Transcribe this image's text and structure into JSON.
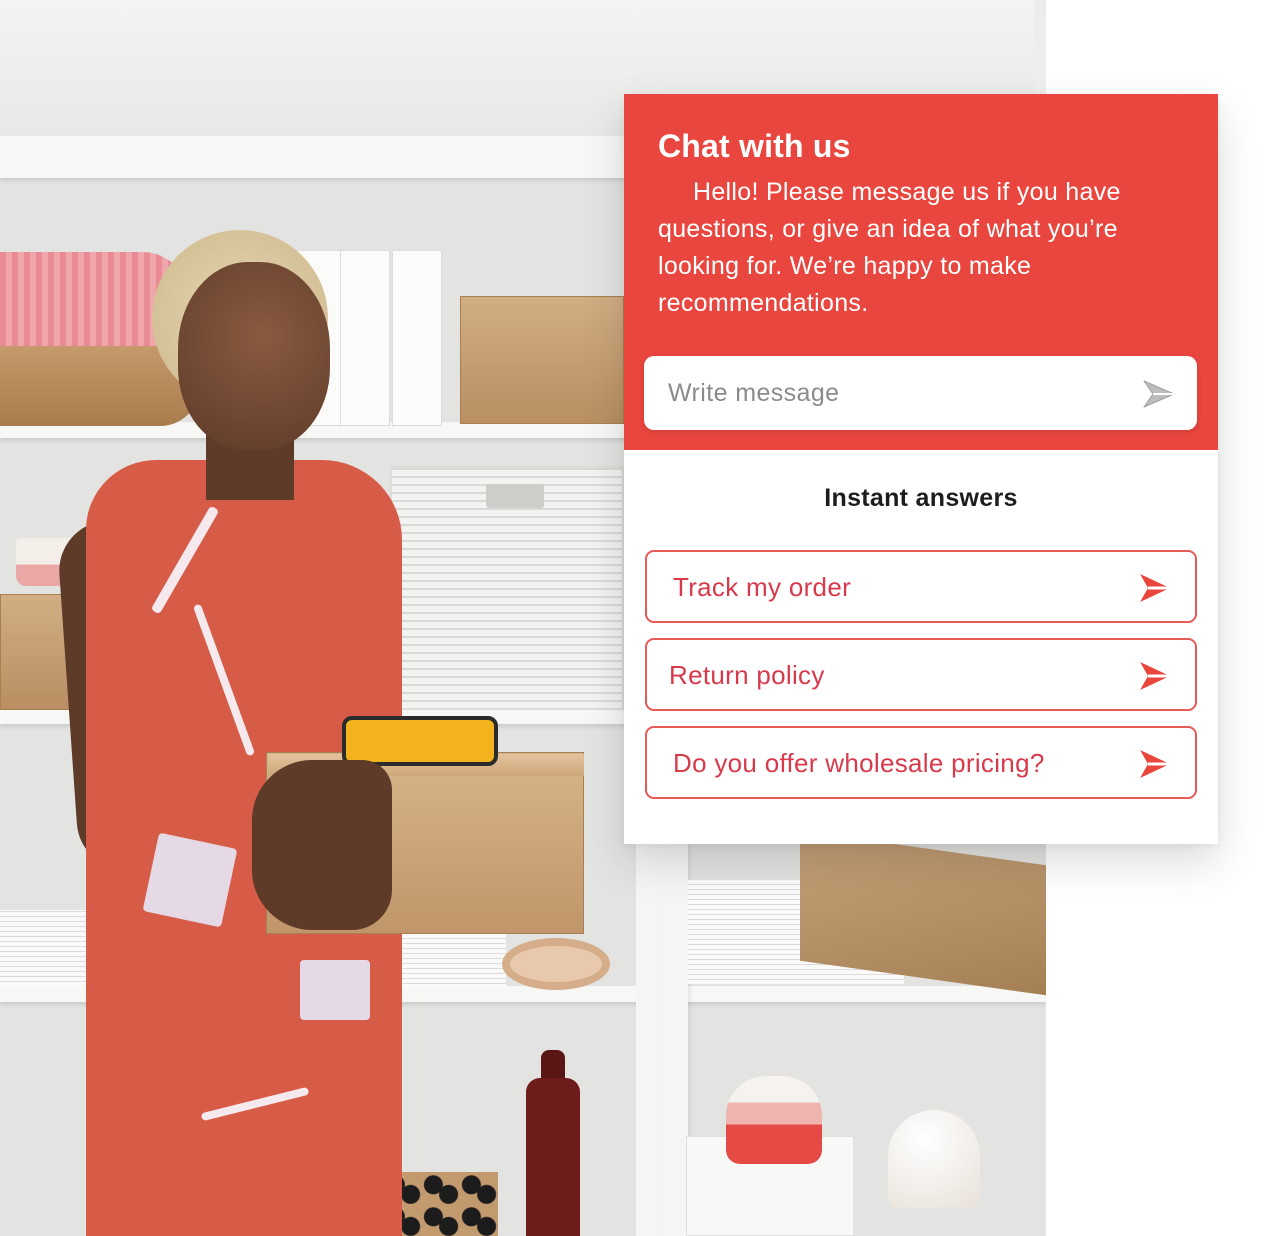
{
  "chat": {
    "title": "Chat with us",
    "intro": "Hello! Please message us if you have questions, or give an idea of what you’re looking for. We’re happy to make recommendations.",
    "message_placeholder": "Write message",
    "instant_answers_heading": "Instant answers",
    "instant_answers": [
      {
        "label": "Track my order"
      },
      {
        "label": "Return policy"
      },
      {
        "label": "Do you offer wholesale pricing?"
      }
    ]
  },
  "colors": {
    "header_bg": "#e8463e",
    "answer_border": "#e65a57",
    "answer_text": "#d83a4b",
    "arrow": "#e8463e",
    "send_icon": "#b9b9b9"
  },
  "icons": {
    "send": "send-arrow-icon",
    "answer": "send-arrow-icon"
  }
}
